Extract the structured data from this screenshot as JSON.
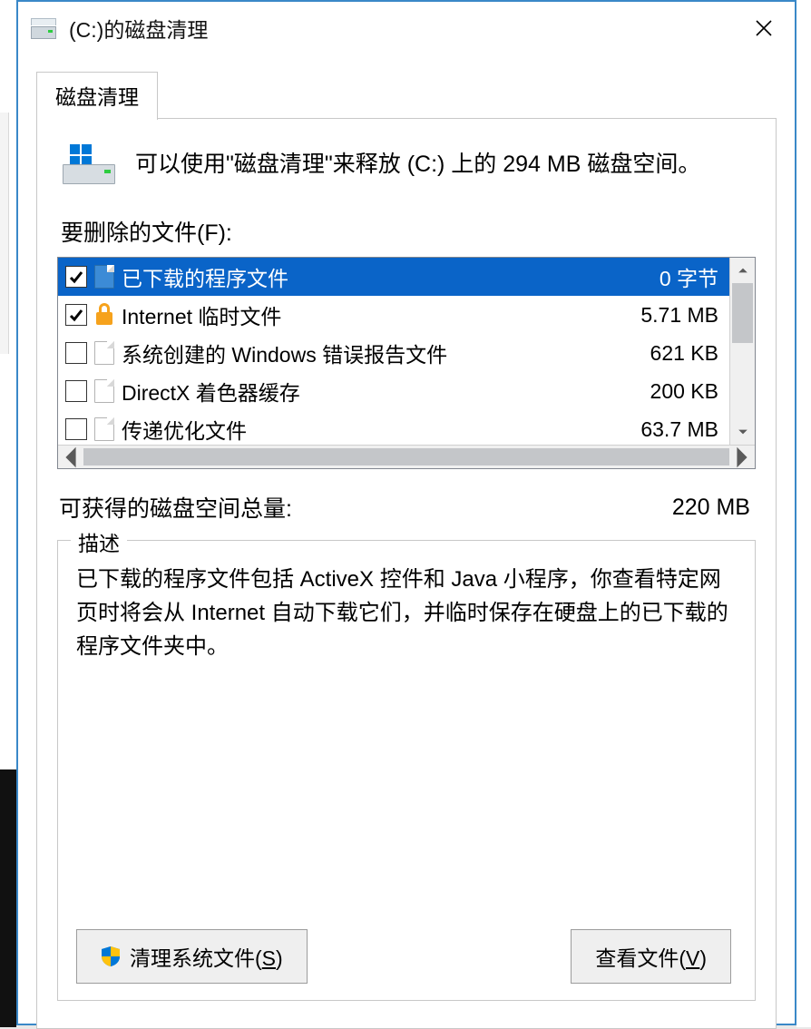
{
  "window": {
    "title": "(C:)的磁盘清理"
  },
  "tabs": [
    {
      "label": "磁盘清理"
    }
  ],
  "hero": {
    "text": "可以使用\"磁盘清理\"来释放  (C:) 上的 294 MB 磁盘空间。"
  },
  "files_label": "要删除的文件(F):",
  "files": [
    {
      "checked": true,
      "selected": true,
      "icon": "blue",
      "name": "已下载的程序文件",
      "size": "0 字节"
    },
    {
      "checked": true,
      "selected": false,
      "icon": "lock",
      "name": "Internet 临时文件",
      "size": "5.71 MB"
    },
    {
      "checked": false,
      "selected": false,
      "icon": "file",
      "name": "系统创建的 Windows 错误报告文件",
      "size": "621 KB"
    },
    {
      "checked": false,
      "selected": false,
      "icon": "file",
      "name": "DirectX 着色器缓存",
      "size": "200 KB"
    },
    {
      "checked": false,
      "selected": false,
      "icon": "file",
      "name": "传递优化文件",
      "size": "63.7 MB"
    }
  ],
  "total": {
    "label": "可获得的磁盘空间总量:",
    "value": "220 MB"
  },
  "description": {
    "legend": "描述",
    "text": "已下载的程序文件包括 ActiveX 控件和 Java 小程序，你查看特定网页时将会从 Internet 自动下载它们，并临时保存在硬盘上的已下载的程序文件夹中。"
  },
  "buttons": {
    "clean_pre": "清理系统文件(",
    "clean_u": "S",
    "clean_post": ")",
    "view_pre": "查看文件(",
    "view_u": "V",
    "view_post": ")"
  }
}
